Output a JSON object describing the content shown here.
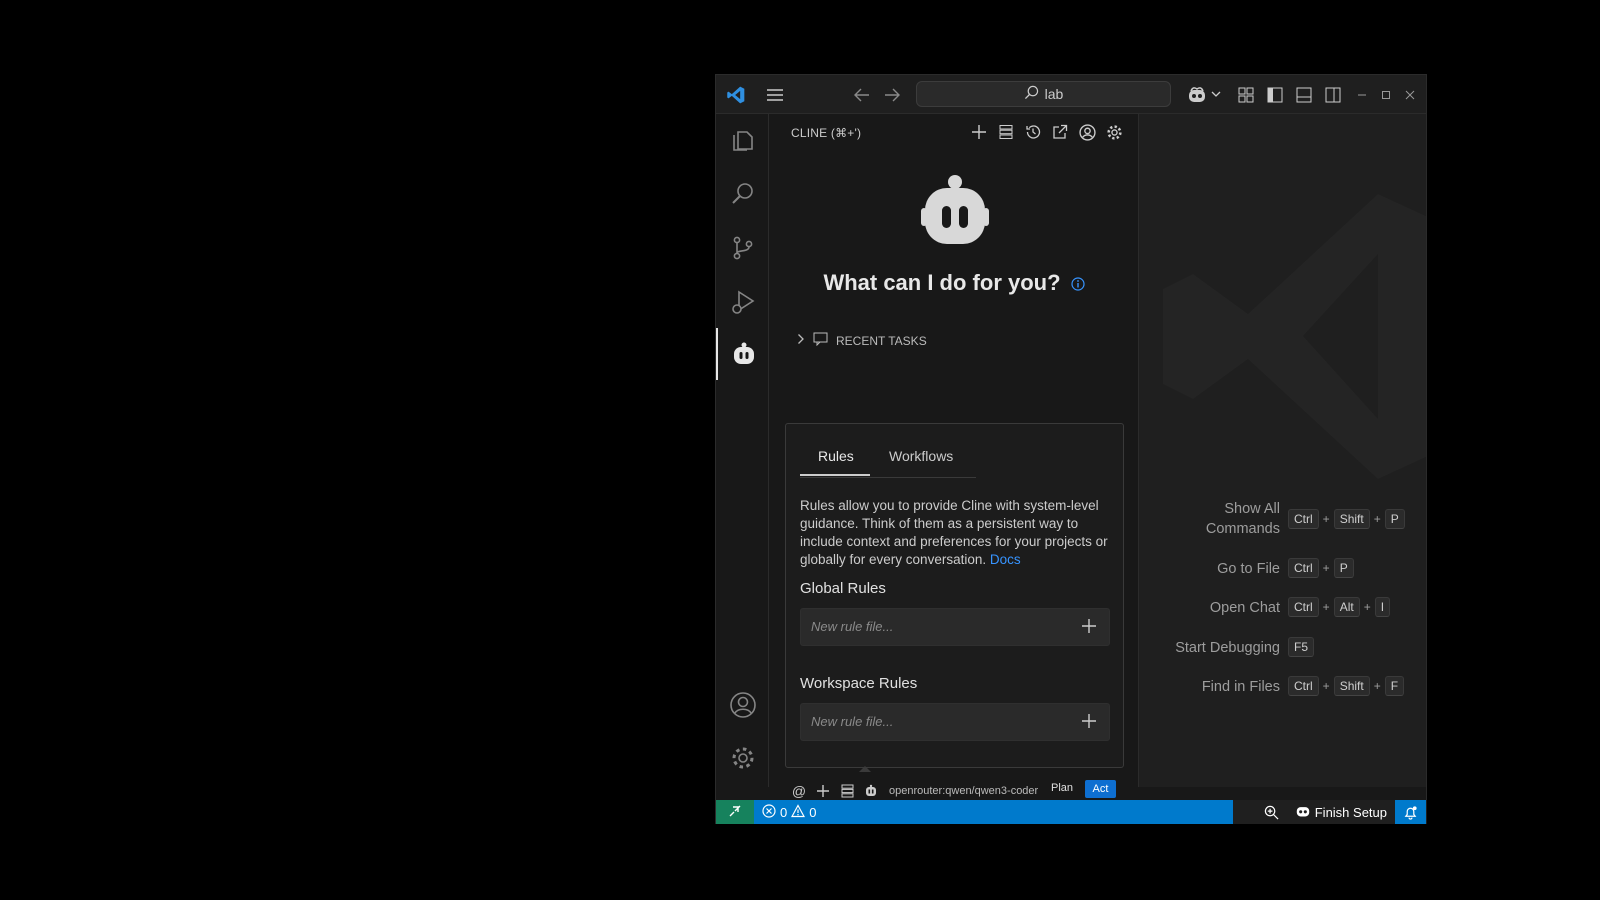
{
  "titlebar": {
    "search_text": "lab",
    "icons": [
      "vscode-logo",
      "menu-icon",
      "back-arrow-icon",
      "forward-arrow-icon",
      "search-icon",
      "copilot-icon",
      "chevron-down-icon",
      "customize-layout-icon",
      "toggle-primary-sidebar-icon",
      "toggle-panel-icon",
      "toggle-secondary-sidebar-icon",
      "minimize-icon",
      "maximize-icon",
      "close-icon"
    ]
  },
  "activitybar": {
    "items": [
      "explorer-icon",
      "search-icon",
      "source-control-icon",
      "run-debug-icon",
      "cline-icon"
    ],
    "bottom": [
      "accounts-icon",
      "manage-icon"
    ]
  },
  "cline": {
    "title": "CLINE (⌘+')",
    "header_icons": [
      "plus-icon",
      "server-icon",
      "history-icon",
      "popout-icon",
      "account-icon",
      "settings-icon"
    ],
    "heading": "What can I do for you?",
    "recent_tasks": "RECENT TASKS",
    "tabs": [
      {
        "label": "Rules"
      },
      {
        "label": "Workflows"
      }
    ],
    "description": "Rules allow you to provide Cline with system-level guidance. Think of them as a persistent way to include context and preferences for your projects or globally for every conversation.",
    "docs_link": "Docs",
    "global_rules": "Global Rules",
    "workspace_rules": "Workspace Rules",
    "new_rule_placeholder": "New rule file...",
    "at_symbol": "@",
    "model": "openrouter:qwen/qwen3-coder",
    "plan": "Plan",
    "act": "Act"
  },
  "welcome": {
    "shortcuts": [
      {
        "label": "Show All Commands",
        "keys": [
          "Ctrl",
          "Shift",
          "P"
        ]
      },
      {
        "label": "Go to File",
        "keys": [
          "Ctrl",
          "P"
        ]
      },
      {
        "label": "Open Chat",
        "keys": [
          "Ctrl",
          "Alt",
          "I"
        ]
      },
      {
        "label": "Start Debugging",
        "keys": [
          "F5"
        ]
      },
      {
        "label": "Find in Files",
        "keys": [
          "Ctrl",
          "Shift",
          "F"
        ]
      }
    ]
  },
  "statusbar": {
    "errors": "0",
    "warnings": "0",
    "finish_setup": "Finish Setup"
  },
  "colors": {
    "accent": "#007acc",
    "remote": "#16825d",
    "act_button": "#0e6fd1",
    "link": "#3794ff"
  }
}
